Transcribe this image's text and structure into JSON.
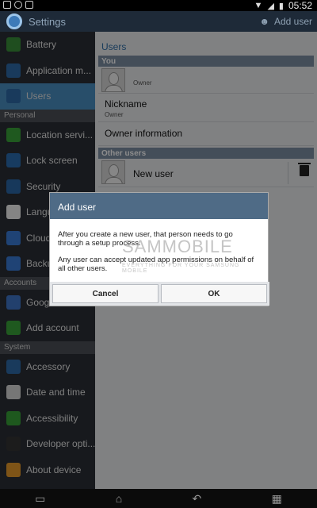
{
  "status_bar": {
    "time": "05:52"
  },
  "action_bar": {
    "title": "Settings",
    "add_user_label": "Add user"
  },
  "sidebar": {
    "items_top": [
      {
        "label": "Battery",
        "icon": "battery-icon",
        "color": "#3a8f3a"
      },
      {
        "label": "Application m...",
        "icon": "app-grid-icon",
        "color": "#2f6aa8"
      },
      {
        "label": "Users",
        "icon": "user-icon",
        "color": "#2f6aa8",
        "selected": true
      }
    ],
    "personal_header": "Personal",
    "items_personal": [
      {
        "label": "Location servi...",
        "icon": "location-icon",
        "color": "#39a339"
      },
      {
        "label": "Lock screen",
        "icon": "lock-screen-icon",
        "color": "#2a6cb0"
      },
      {
        "label": "Security",
        "icon": "security-icon",
        "color": "#2b66a6"
      },
      {
        "label": "Langu...",
        "icon": "language-icon",
        "color": "#f0f0f0"
      },
      {
        "label": "Cloud",
        "icon": "cloud-icon",
        "color": "#3a7bd5"
      },
      {
        "label": "Backu...",
        "icon": "backup-icon",
        "color": "#3a7bd5"
      }
    ],
    "accounts_header": "Accounts",
    "items_accounts": [
      {
        "label": "Google",
        "icon": "google-icon",
        "color": "#3f75c7"
      },
      {
        "label": "Add account",
        "icon": "add-account-icon",
        "color": "#3aa23a"
      }
    ],
    "system_header": "System",
    "items_system": [
      {
        "label": "Accessory",
        "icon": "accessory-icon",
        "color": "#2f6aa8"
      },
      {
        "label": "Date and time",
        "icon": "clock-icon",
        "color": "#d7d7d7"
      },
      {
        "label": "Accessibility",
        "icon": "accessibility-icon",
        "color": "#37a037"
      },
      {
        "label": "Developer opti...",
        "icon": "developer-icon",
        "color": "#333333"
      },
      {
        "label": "About device",
        "icon": "info-icon",
        "color": "#e69a2a"
      }
    ]
  },
  "content": {
    "title": "Users",
    "you_header": "You",
    "owner_label": "Owner",
    "nickname_label": "Nickname",
    "nickname_value": "Owner",
    "owner_information": "Owner information",
    "other_users_header": "Other users",
    "new_user_label": "New user"
  },
  "dialog": {
    "title": "Add user",
    "message_1": "After you create a new user, that person needs to go through a setup process.",
    "message_2": "Any user can accept updated app permissions on behalf of all other users.",
    "cancel_label": "Cancel",
    "ok_label": "OK"
  },
  "watermark": {
    "main": "SAMMOBILE",
    "sub": "EVERYTHING FOR YOUR SAMSUNG MOBILE"
  },
  "colors": {
    "accent": "#4a8fc2",
    "dialog_header": "#4f6b86",
    "section_header": "#7d8fa2"
  }
}
